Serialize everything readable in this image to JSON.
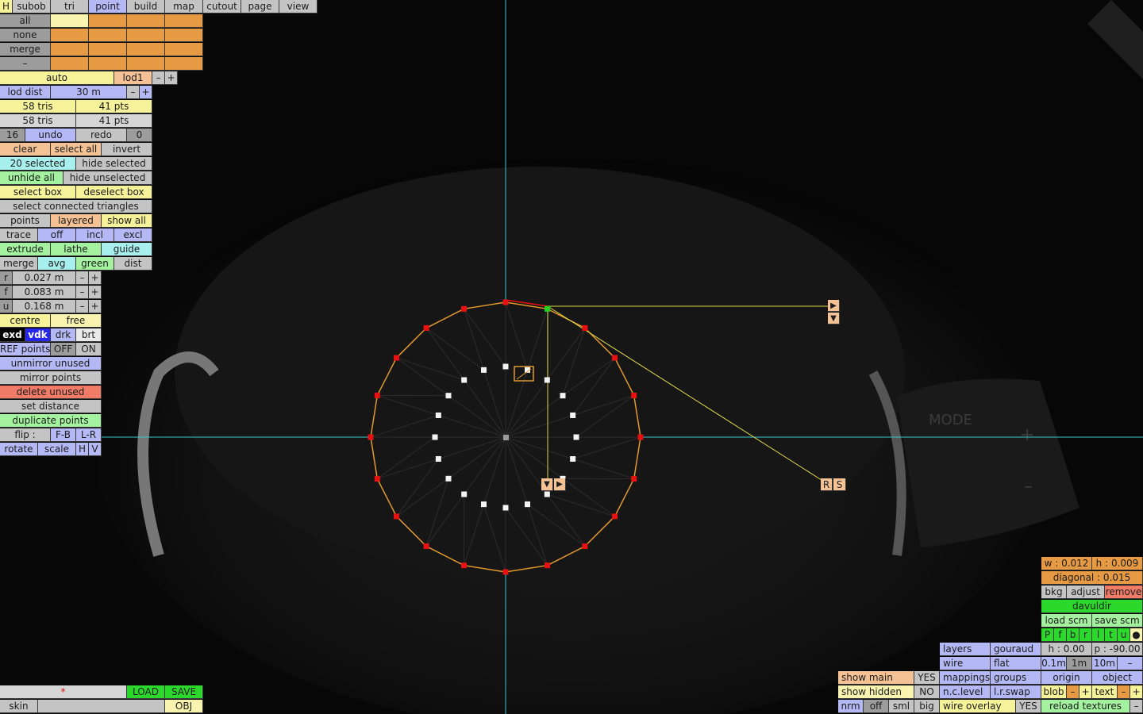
{
  "menu": {
    "h": "H",
    "items": [
      "subob",
      "tri",
      "point",
      "build",
      "map",
      "cutout",
      "page",
      "view"
    ]
  },
  "select_rows": [
    "all",
    "none",
    "merge",
    "–"
  ],
  "lod": {
    "auto": "auto",
    "level": "lod1",
    "minus": "–",
    "plus": "+"
  },
  "lod_dist": {
    "label": "lod dist",
    "value": "30 m",
    "minus": "–",
    "plus": "+"
  },
  "counts": {
    "tris1": "58 tris",
    "pts1": "41 pts",
    "tris2": "58 tris",
    "pts2": "41 pts"
  },
  "history": {
    "undo_count": "16",
    "undo": "undo",
    "redo": "redo",
    "redo_count": "0"
  },
  "selection": {
    "clear": "clear",
    "select_all": "select all",
    "invert": "invert",
    "selected": "20 selected",
    "hide_selected": "hide selected",
    "unhide_all": "unhide all",
    "hide_unselected": "hide unselected",
    "select_box": "select box",
    "deselect_box": "deselect box",
    "select_connected": "select connected triangles"
  },
  "display": {
    "points": "points",
    "layered": "layered",
    "show_all": "show all"
  },
  "trace": {
    "trace": "trace",
    "off": "off",
    "incl": "incl",
    "excl": "excl"
  },
  "tools": {
    "extrude": "extrude",
    "lathe": "lathe",
    "guide": "guide",
    "merge": "merge",
    "avg": "avg",
    "green": "green",
    "dist": "dist"
  },
  "params": [
    {
      "axis": "r",
      "value": "0.027 m",
      "minus": "–",
      "plus": "+"
    },
    {
      "axis": "f",
      "value": "0.083 m",
      "minus": "–",
      "plus": "+"
    },
    {
      "axis": "u",
      "value": "0.168 m",
      "minus": "–",
      "plus": "+"
    }
  ],
  "mode": {
    "centre": "centre",
    "free": "free"
  },
  "shade": {
    "exd": "exd",
    "vdk": "vdk",
    "drk": "drk",
    "brt": "brt"
  },
  "ref": {
    "label": "REF points",
    "off": "OFF",
    "on": "ON"
  },
  "actions": {
    "unmirror": "unmirror unused",
    "mirror": "mirror points",
    "delete": "delete unused",
    "set_distance": "set distance",
    "duplicate": "duplicate points"
  },
  "flip": {
    "label": "flip :",
    "fb": "F-B",
    "lr": "L-R"
  },
  "transform": {
    "rotate": "rotate",
    "scale": "scale",
    "h": "H",
    "v": "V"
  },
  "bottom_left": {
    "marker": "*",
    "load": "LOAD",
    "save": "SAVE",
    "skin": "skin",
    "obj": "OBJ"
  },
  "viewport": {
    "handle_up": "▲",
    "handle_down": "▼",
    "handle_right": "▶",
    "r": "R",
    "s": "S",
    "colors": {
      "axis": "#39c6cf",
      "ring": "#e39a2d",
      "guide": "#e0d84a",
      "point_red": "#e81010",
      "point_green": "#22d022"
    }
  },
  "info": {
    "w": "w : 0.012",
    "h": "h : 0.009",
    "diagonal": "diagonal : 0.015",
    "bkg": "bkg",
    "adjust": "adjust",
    "remove": "remove",
    "name": "davuldir",
    "load_scm": "load scm",
    "save_scm": "save scm",
    "flags": [
      "P",
      "f",
      "b",
      "r",
      "l",
      "t",
      "u",
      "●"
    ]
  },
  "render": {
    "layers": "layers",
    "gouraud": "gouraud",
    "wire": "wire",
    "flat": "flat",
    "mappings": "mappings",
    "groups": "groups",
    "nclevel": "n.c.level",
    "lrswap": "l.r.swap",
    "wire_overlay": "wire overlay",
    "wire_overlay_val": "YES"
  },
  "view_params": {
    "h": "h : 0.00",
    "p": "p : -90.00",
    "g1": "0.1m",
    "g2": "1m",
    "g3": "10m",
    "minus": "–",
    "origin": "origin",
    "object": "object",
    "blob": "blob",
    "text": "text",
    "reload": "reload textures"
  },
  "show": {
    "main": "show main",
    "main_val": "YES",
    "hidden": "show hidden",
    "hidden_val": "NO",
    "nrm": "nrm",
    "off": "off",
    "sml": "sml",
    "big": "big"
  }
}
